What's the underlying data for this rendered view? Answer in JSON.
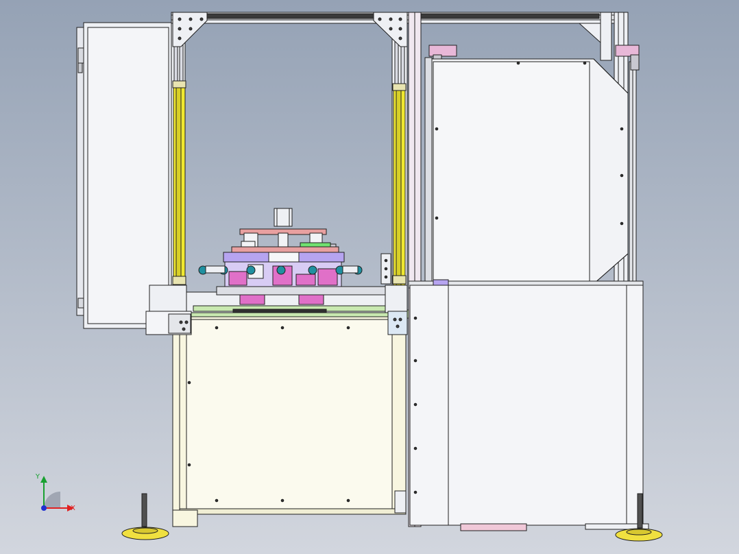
{
  "viewport": {
    "background_top": "#95a2b5",
    "background_bottom": "#d2d6de"
  },
  "triad": {
    "x_label": "X",
    "y_label": "Y",
    "x_color": "#e02020",
    "y_color": "#18a030",
    "z_color": "#2030d0"
  },
  "colors": {
    "frame": "#eef0f4",
    "outline": "#202020",
    "light_curtain": "#f0e830",
    "panel_cream": "#f8f6e0",
    "fixture_pink": "#e070c8",
    "fixture_violet": "#b6a4f0",
    "plate_salmon": "#e8a0a0",
    "sensor_teal": "#2090a0",
    "cylinder_green": "#70e070",
    "foot_yellow": "#f0e040",
    "base_green": "#c8e8b0"
  }
}
